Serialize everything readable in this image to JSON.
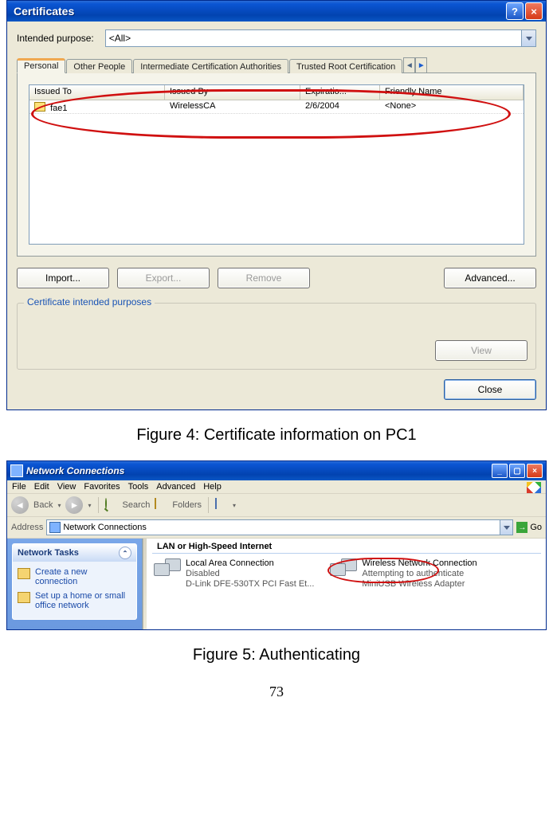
{
  "fig4": {
    "window_title": "Certificates",
    "purpose_label": "Intended purpose:",
    "purpose_value": "<All>",
    "tabs": [
      "Personal",
      "Other People",
      "Intermediate Certification Authorities",
      "Trusted Root Certification"
    ],
    "columns": {
      "c1": "Issued To",
      "c2": "Issued By",
      "c3": "Expiratio...",
      "c4": "Friendly Name"
    },
    "rows": [
      {
        "issued_to": "fae1",
        "issued_by": "WirelessCA",
        "expiration": "2/6/2004",
        "friendly": "<None>"
      }
    ],
    "buttons": {
      "import": "Import...",
      "export": "Export...",
      "remove": "Remove",
      "advanced": "Advanced...",
      "view": "View",
      "close": "Close"
    },
    "group_legend": "Certificate intended purposes",
    "caption": "Figure 4: Certificate information on PC1"
  },
  "fig5": {
    "window_title": "Network Connections",
    "menus": [
      "File",
      "Edit",
      "View",
      "Favorites",
      "Tools",
      "Advanced",
      "Help"
    ],
    "toolbar": {
      "back": "Back",
      "search": "Search",
      "folders": "Folders"
    },
    "address_label": "Address",
    "address_value": "Network Connections",
    "go_label": "Go",
    "tasks_title": "Network Tasks",
    "tasks": [
      "Create a new connection",
      "Set up a home or small office network"
    ],
    "group_header": "LAN or High-Speed Internet",
    "connections": [
      {
        "name": "Local Area Connection",
        "line2": "Disabled",
        "line3": "D-Link DFE-530TX PCI Fast Et..."
      },
      {
        "name": "Wireless Network Connection",
        "line2": "Attempting to authenticate",
        "line3": "MiniUSB Wireless Adapter"
      }
    ],
    "caption": "Figure 5: Authenticating"
  },
  "page_number": "73"
}
